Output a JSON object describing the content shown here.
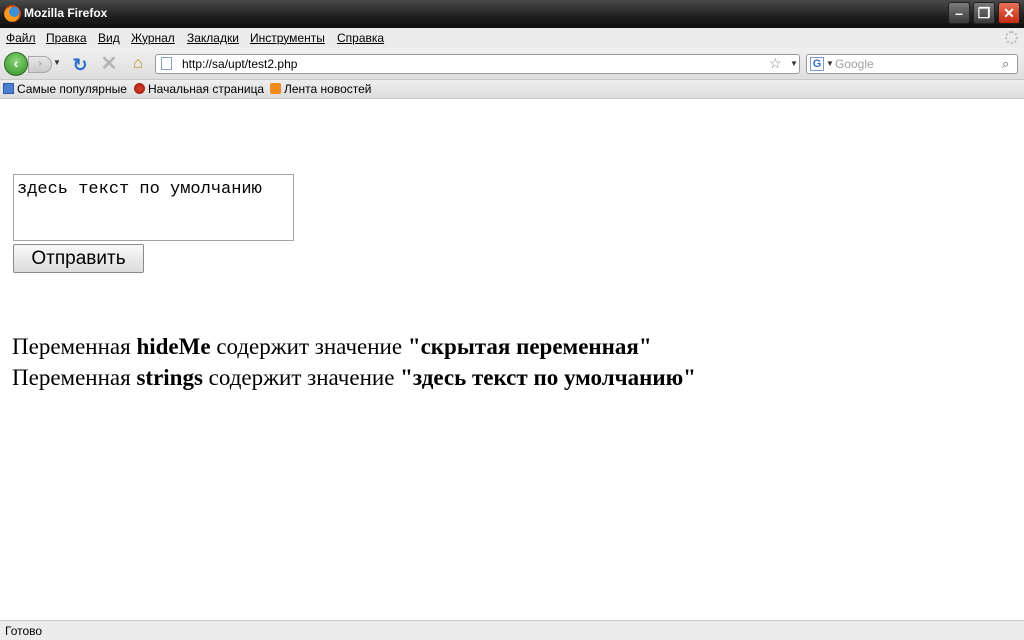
{
  "window": {
    "title": "Mozilla Firefox"
  },
  "menu": {
    "items": [
      "Файл",
      "Правка",
      "Вид",
      "Журнал",
      "Закладки",
      "Инструменты",
      "Справка"
    ]
  },
  "nav": {
    "url": "http://sa/upt/test2.php",
    "search_placeholder": "Google",
    "search_engine_letter": "G"
  },
  "bookmarks": [
    "Самые популярные",
    "Начальная страница",
    "Лента новостей"
  ],
  "form": {
    "textarea_value": "здесь текст по умолчанию",
    "submit_label": "Отправить"
  },
  "output": {
    "line1": {
      "prefix": "Переменная ",
      "var": "hideMe",
      "middle": " содержит значение ",
      "value": "\"скрытая переменная\""
    },
    "line2": {
      "prefix": "Переменная ",
      "var": "strings",
      "middle": " содержит значение ",
      "value": "\"здесь текст по умолчанию\""
    }
  },
  "status": {
    "text": "Готово"
  },
  "colors": {
    "accent_back": "#2f8f23",
    "close_button": "#c42b10",
    "link_reload": "#2f6fd0"
  }
}
